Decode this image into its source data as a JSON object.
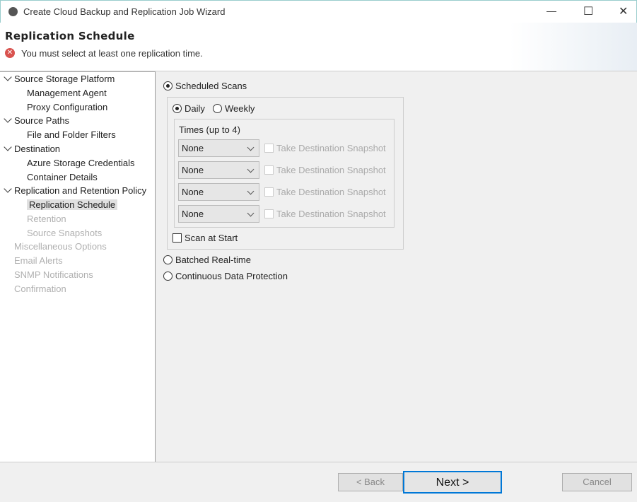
{
  "window": {
    "title": "Create Cloud Backup and Replication Job Wizard",
    "minimize": "—",
    "maximize": "☐",
    "close": "✕"
  },
  "header": {
    "page_title": "Replication Schedule",
    "error": "You must select at least one replication time."
  },
  "tree": [
    {
      "label": "Source Storage Platform",
      "level": 0,
      "state": "normal"
    },
    {
      "label": "Management Agent",
      "level": 1,
      "state": "normal"
    },
    {
      "label": "Proxy Configuration",
      "level": 1,
      "state": "normal"
    },
    {
      "label": "Source Paths",
      "level": 0,
      "state": "normal"
    },
    {
      "label": "File and Folder Filters",
      "level": 1,
      "state": "normal"
    },
    {
      "label": "Destination",
      "level": 0,
      "state": "normal"
    },
    {
      "label": "Azure Storage Credentials",
      "level": 1,
      "state": "normal"
    },
    {
      "label": "Container Details",
      "level": 1,
      "state": "normal"
    },
    {
      "label": "Replication and Retention Policy",
      "level": 0,
      "state": "normal"
    },
    {
      "label": "Replication Schedule",
      "level": 1,
      "state": "selected"
    },
    {
      "label": "Retention",
      "level": 1,
      "state": "disabled"
    },
    {
      "label": "Source Snapshots",
      "level": 1,
      "state": "disabled"
    },
    {
      "label": "Miscellaneous Options",
      "level": 0,
      "state": "disabled"
    },
    {
      "label": "Email Alerts",
      "level": 0,
      "state": "disabled"
    },
    {
      "label": "SNMP Notifications",
      "level": 0,
      "state": "disabled"
    },
    {
      "label": "Confirmation",
      "level": 0,
      "state": "disabled"
    }
  ],
  "schedule": {
    "scheduled_scans": "Scheduled Scans",
    "daily": "Daily",
    "weekly": "Weekly",
    "times_label": "Times (up to 4)",
    "times": [
      {
        "value": "None",
        "snapshot": "Take Destination Snapshot"
      },
      {
        "value": "None",
        "snapshot": "Take Destination Snapshot"
      },
      {
        "value": "None",
        "snapshot": "Take Destination Snapshot"
      },
      {
        "value": "None",
        "snapshot": "Take Destination Snapshot"
      }
    ],
    "scan_at_start": "Scan at Start",
    "batched": "Batched Real-time",
    "cdp": "Continuous Data Protection"
  },
  "footer": {
    "back": "< Back",
    "next": "Next >",
    "cancel": "Cancel"
  }
}
